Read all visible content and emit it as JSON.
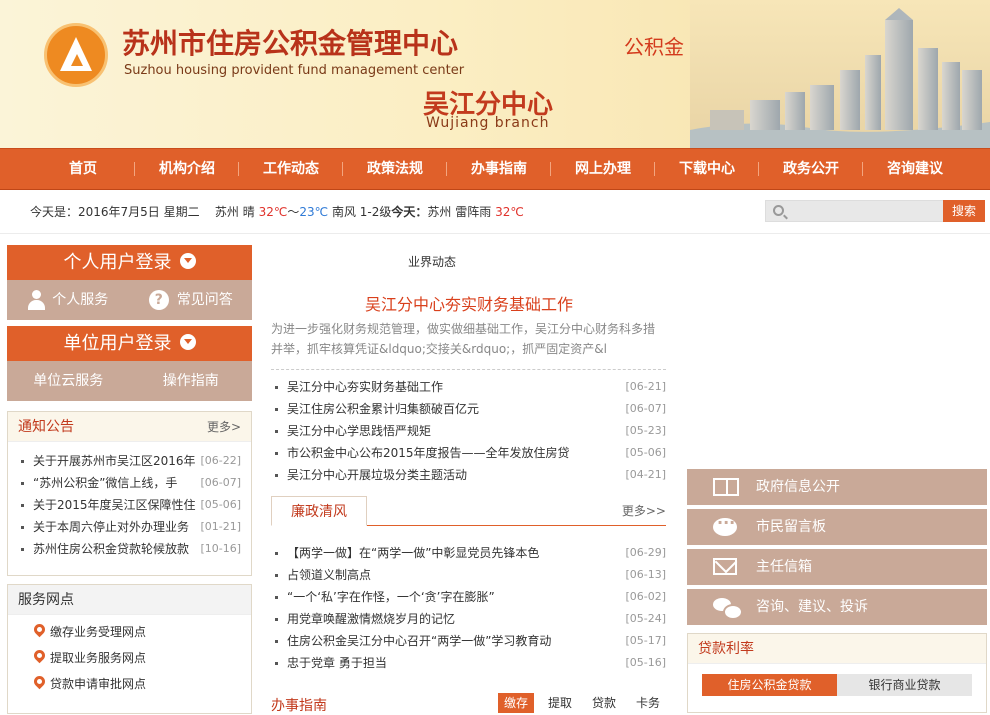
{
  "header": {
    "site_title": "苏州市住房公积金管理中心",
    "site_subtitle": "Suzhou housing provident fund management center",
    "branch_title": "吴江分中心",
    "branch_subtitle": "Wujiang branch",
    "slogan": "公积金  惠万家"
  },
  "nav": {
    "items": [
      "首页",
      "机构介绍",
      "工作动态",
      "政策法规",
      "办事指南",
      "网上办理",
      "下载中心",
      "政务公开",
      "咨询建议"
    ]
  },
  "infobar": {
    "date_text": "今天是：2016年7月5日 星期二",
    "city1": "苏州",
    "cond1": "晴",
    "high1": "32℃",
    "sep": "～",
    "low1": "23℃",
    "wind": "南风 1-2级",
    "today_label": "今天：",
    "city2": "苏州",
    "cond2": "雷阵雨",
    "high2": "32℃"
  },
  "search": {
    "placeholder": "",
    "button_label": "搜索"
  },
  "login": {
    "personal_title": "个人用户登录",
    "personal_service": "个人服务",
    "faq": "常见问答",
    "unit_title": "单位用户登录",
    "unit_cloud": "单位云服务",
    "op_guide": "操作指南"
  },
  "notice": {
    "title": "通知公告",
    "more": "更多>",
    "items": [
      {
        "text": "关于开展苏州市吴江区2016年",
        "date": "[06-22]"
      },
      {
        "text": "“苏州公积金”微信上线，手",
        "date": "[06-07]"
      },
      {
        "text": "关于2015年度吴江区保障性住",
        "date": "[05-06]"
      },
      {
        "text": "关于本周六停止对外办理业务",
        "date": "[01-21]"
      },
      {
        "text": "苏州住房公积金贷款轮候放款",
        "date": "[10-16]"
      }
    ]
  },
  "service": {
    "title": "服务网点",
    "items": [
      "缴存业务受理网点",
      "提取业务服务网点",
      "贷款申请审批网点"
    ]
  },
  "industry": {
    "label": "业界动态",
    "headline": "吴江分中心夯实财务基础工作",
    "summary": "为进一步强化财务规范管理，做实做细基础工作，吴江分中心财务科多措并举，抓牢核算凭证&ldquo;交接关&rdquo;，抓严固定资产&l",
    "items": [
      {
        "text": "吴江分中心夯实财务基础工作",
        "date": "[06-21]"
      },
      {
        "text": "吴江住房公积金累计归集额破百亿元",
        "date": "[06-07]"
      },
      {
        "text": "吴江分中心学思践悟严规矩",
        "date": "[05-23]"
      },
      {
        "text": "市公积金中心公布2015年度报告——全年发放住房贷",
        "date": "[05-06]"
      },
      {
        "text": "吴江分中心开展垃圾分类主题活动",
        "date": "[04-21]"
      }
    ]
  },
  "clean": {
    "tab": "廉政清风",
    "more": "更多>>",
    "items": [
      {
        "text": "【两学一做】在“两学一做”中彰显党员先锋本色",
        "date": "[06-29]"
      },
      {
        "text": "占领道义制高点",
        "date": "[06-13]"
      },
      {
        "text": "“一个‘私’字在作怪，一个‘贪’字在膨胀”",
        "date": "[06-02]"
      },
      {
        "text": "用党章唤醒激情燃烧岁月的记忆",
        "date": "[05-24]"
      },
      {
        "text": "住房公积金吴江分中心召开“两学一做”学习教育动",
        "date": "[05-17]"
      },
      {
        "text": "忠于党章 勇于担当",
        "date": "[05-16]"
      }
    ]
  },
  "guide": {
    "title": "办事指南",
    "tabs": [
      "缴存",
      "提取",
      "贷款",
      "卡务"
    ]
  },
  "right_links": [
    "政府信息公开",
    "市民留言板",
    "主任信箱",
    "咨询、建议、投诉"
  ],
  "rates": {
    "title": "贷款利率",
    "tabs": [
      "住房公积金贷款",
      "银行商业贷款"
    ]
  },
  "colors": {
    "primary": "#e0602a",
    "accent_red": "#c23a1d",
    "muted_brown": "#c9a998"
  }
}
